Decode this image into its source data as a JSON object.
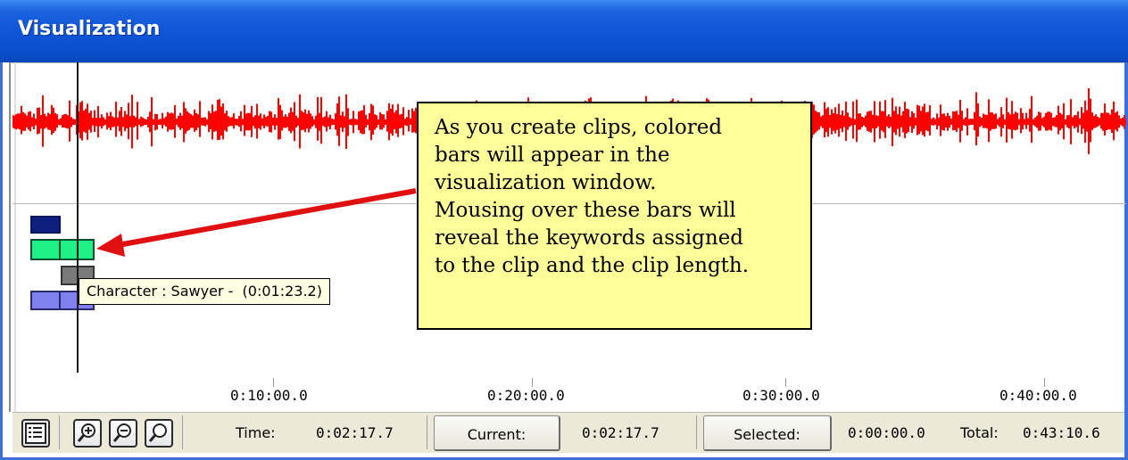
{
  "window": {
    "title": "Visualization"
  },
  "colors": {
    "waveform": "#ff0000",
    "clip_navy": "#0f1f80",
    "clip_green": "#1ff085",
    "clip_gray": "#7a7a7a",
    "clip_purple": "#8080f0",
    "callout_bg": "#ffff9a",
    "arrow": "#e01010"
  },
  "tooltip": {
    "text": "Character : Sawyer -  (0:01:23.2)"
  },
  "callout": {
    "lines": [
      "As you create clips, colored",
      "bars will appear in the",
      "visualization window.",
      "Mousing over these bars will",
      "reveal the keywords assigned",
      "to the clip and the clip length."
    ]
  },
  "timeline": {
    "ticks": [
      "0:10:00.0",
      "0:20:00.0",
      "0:30:00.0",
      "0:40:00.0"
    ]
  },
  "statusbar": {
    "icons": [
      "list-icon",
      "zoom-in-icon",
      "zoom-out-icon",
      "zoom-icon"
    ],
    "time_label": "Time:",
    "time_value": "0:02:17.7",
    "current_button": "Current:",
    "current_value": "0:02:17.7",
    "selected_button": "Selected:",
    "selected_value": "0:00:00.0",
    "total_label": "Total:",
    "total_value": "0:43:10.6"
  }
}
